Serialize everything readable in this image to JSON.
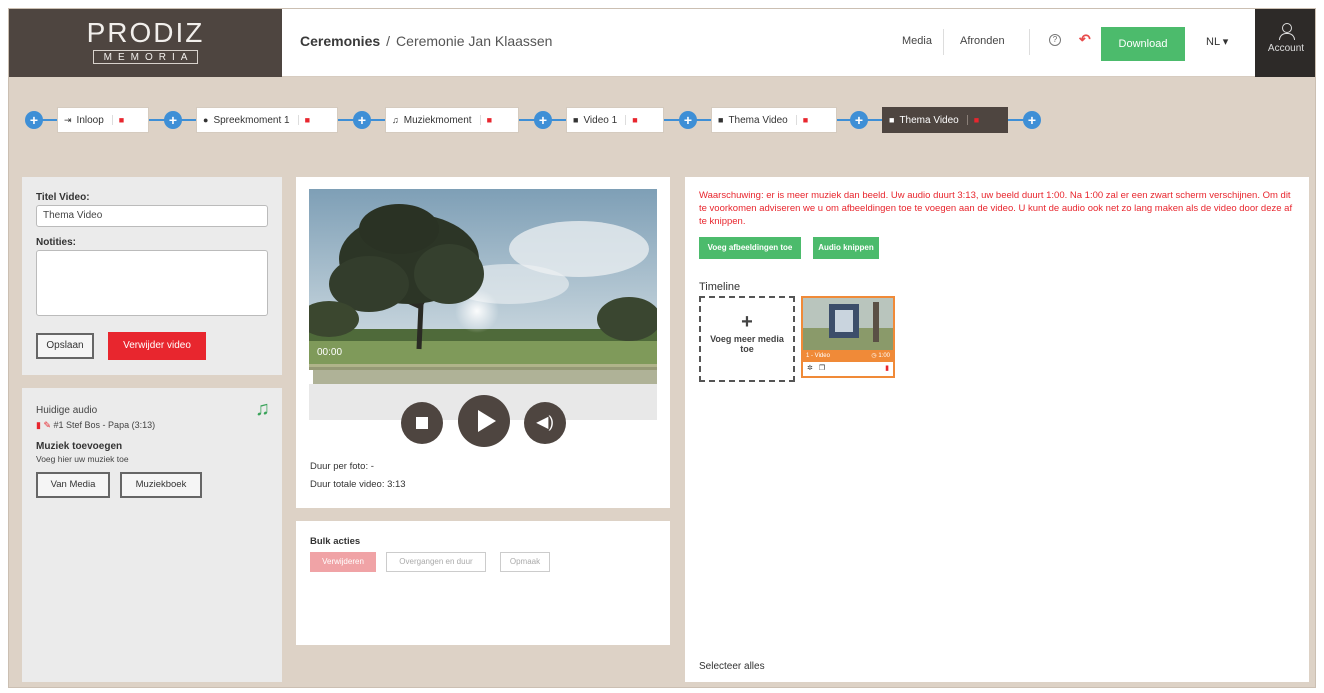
{
  "logo": {
    "top": "PRODIZ",
    "bottom": "MEMORIA"
  },
  "breadcrumb": {
    "root": "Ceremonies",
    "separator": "/",
    "current": "Ceremonie Jan Klaassen"
  },
  "nav": {
    "media": "Media",
    "finish": "Afronden",
    "download": "Download",
    "language": "NL",
    "account": "Account"
  },
  "steps": [
    {
      "label": "Inloop",
      "icon": "sign-in-icon",
      "glyph": "⇥"
    },
    {
      "label": "Spreekmoment 1",
      "icon": "user-icon",
      "glyph": "●"
    },
    {
      "label": "Muziekmoment",
      "icon": "music-icon",
      "glyph": "♫"
    },
    {
      "label": "Video 1",
      "icon": "video-icon",
      "glyph": "■"
    },
    {
      "label": "Thema Video",
      "icon": "video-icon",
      "glyph": "■"
    },
    {
      "label": "Thema Video",
      "icon": "video-icon",
      "glyph": "■",
      "active": true
    }
  ],
  "video_form": {
    "title_label": "Titel Video:",
    "title_value": "Thema Video",
    "notes_label": "Notities:",
    "notes_value": "",
    "save_label": "Opslaan",
    "delete_label": "Verwijder video"
  },
  "audio": {
    "current_label": "Huidige audio",
    "track": "#1 Stef Bos - Papa (3:13)",
    "add_title": "Muziek toevoegen",
    "add_hint": "Voeg hier uw muziek toe",
    "from_media": "Van Media",
    "music_book": "Muziekboek"
  },
  "player": {
    "time": "00:00",
    "progress": 0,
    "duration_per_photo": "Duur per foto: -",
    "duration_total": "Duur totale video: 3:13"
  },
  "bulk": {
    "title": "Bulk acties",
    "delete": "Verwijderen",
    "transitions": "Overgangen en duur",
    "layout": "Opmaak"
  },
  "timeline_panel": {
    "warning": "Waarschuwing: er is meer muziek dan beeld. Uw audio duurt 3:13, uw beeld duurt 1:00. Na 1:00 zal er een zwart scherm verschijnen. Om dit te voorkomen adviseren we u om afbeeldingen toe te voegen aan de video. U kunt de audio ook net zo lang maken als de video door deze af te knippen.",
    "add_images": "Voeg afbeeldingen toe",
    "cut_audio": "Audio knippen",
    "timeline_title": "Timeline",
    "add_media_plus": "+",
    "add_media": "Voeg meer media toe",
    "item_label": "1 - Video",
    "item_duration": "1:00",
    "select_all": "Selecteer alles"
  },
  "colors": {
    "brand_dark": "#4e4540",
    "accent_blue": "#3e8fd6",
    "green": "#4cbb6c",
    "red": "#e8262e",
    "orange": "#f08a38",
    "background": "#ddd2c6"
  }
}
